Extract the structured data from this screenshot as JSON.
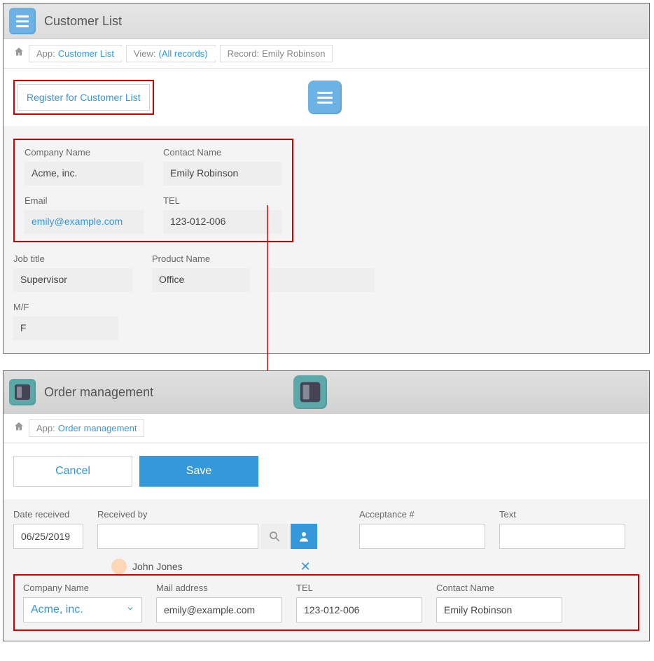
{
  "panel1": {
    "title": "Customer List",
    "breadcrumb": {
      "app_prefix": "App: ",
      "app": "Customer List",
      "view_prefix": "View: ",
      "view": "(All records)",
      "record_prefix": "Record: ",
      "record": "Emily Robinson"
    },
    "register_label": "Register for Customer List",
    "fields": {
      "company_name_label": "Company Name",
      "company_name": "Acme, inc.",
      "contact_name_label": "Contact Name",
      "contact_name": "Emily Robinson",
      "email_label": "Email",
      "email": "emily@example.com",
      "tel_label": "TEL",
      "tel": "123-012-006",
      "job_title_label": "Job title",
      "job_title": "Supervisor",
      "product_name_label": "Product Name",
      "product_name": "Office",
      "mf_label": "M/F",
      "mf": "F"
    }
  },
  "panel2": {
    "title": "Order management",
    "breadcrumb": {
      "app_prefix": "App: ",
      "app": "Order management"
    },
    "cancel_label": "Cancel",
    "save_label": "Save",
    "date_received_label": "Date received",
    "date_received": "06/25/2019",
    "received_by_label": "Received by",
    "received_by_user": "John Jones",
    "acceptance_label": "Acceptance #",
    "text_label": "Text",
    "company_name_label": "Company Name",
    "company_name": "Acme, inc.",
    "mail_label": "Mail address",
    "mail": "emily@example.com",
    "tel_label": "TEL",
    "tel": "123-012-006",
    "contact_name_label": "Contact Name",
    "contact_name": "Emily Robinson"
  },
  "icons": {
    "home": "home-icon",
    "search": "search-icon",
    "person": "person-icon",
    "close": "close-icon",
    "chevron_down": "chevron-down-icon"
  }
}
